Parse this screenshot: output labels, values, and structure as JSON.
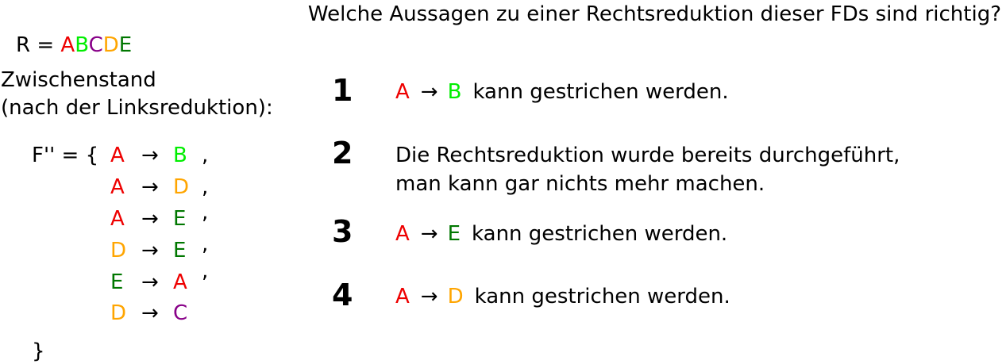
{
  "question": "Welche Aussagen zu einer Rechtsreduktion dieser FDs sind richtig?",
  "relation": {
    "prefix": "R = ",
    "attributes": [
      {
        "letter": "A",
        "color": "#ee0000"
      },
      {
        "letter": "B",
        "color": "#00ee00"
      },
      {
        "letter": "C",
        "color": "#880088"
      },
      {
        "letter": "D",
        "color": "#ffa500"
      },
      {
        "letter": "E",
        "color": "#007700"
      }
    ]
  },
  "intermediate": {
    "line1": "Zwischenstand",
    "line2": "(nach der Linksreduktion):"
  },
  "fds": {
    "open": "F'' = {",
    "close": "}",
    "arrow": "→",
    "items": [
      {
        "lhs": "A",
        "rhs": "B",
        "sep": ","
      },
      {
        "lhs": "A",
        "rhs": "D",
        "sep": ","
      },
      {
        "lhs": "A",
        "rhs": "E",
        "sep": ","
      },
      {
        "lhs": "D",
        "rhs": "E",
        "sep": ","
      },
      {
        "lhs": "E",
        "rhs": "A",
        "sep": ","
      },
      {
        "lhs": "D",
        "rhs": "C",
        "sep": ""
      }
    ]
  },
  "options": [
    {
      "number": "1",
      "lhs": "A",
      "arrow": "→",
      "rhs": "B",
      "text": "kann gestrichen werden."
    },
    {
      "number": "2",
      "line1": "Die Rechtsreduktion wurde bereits durchgeführt,",
      "line2": "man kann gar nichts mehr machen."
    },
    {
      "number": "3",
      "lhs": "A",
      "arrow": "→",
      "rhs": "E",
      "text": "kann gestrichen werden."
    },
    {
      "number": "4",
      "lhs": "A",
      "arrow": "→",
      "rhs": "D",
      "text": "kann gestrichen werden."
    }
  ],
  "colors": {
    "A": "#ee0000",
    "B": "#00ee00",
    "C": "#880088",
    "D": "#ffa500",
    "E": "#007700"
  }
}
